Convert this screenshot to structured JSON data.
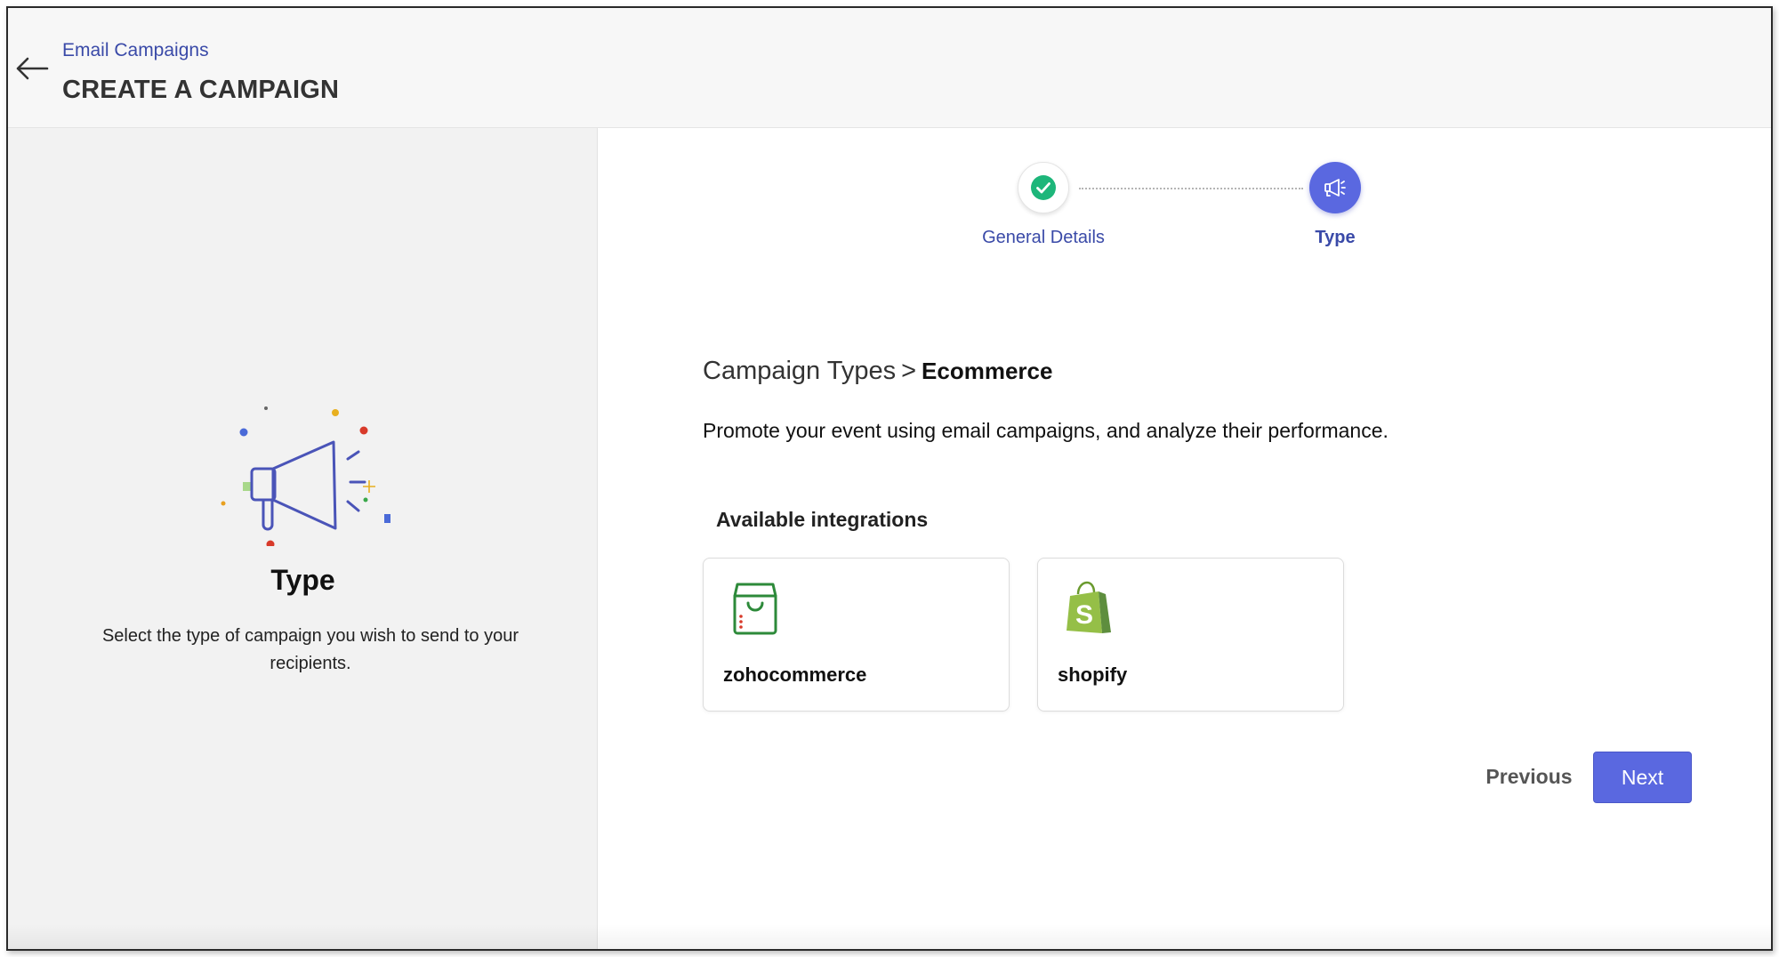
{
  "header": {
    "breadcrumb": "Email Campaigns",
    "title": "CREATE A CAMPAIGN",
    "back_icon": "arrow-left-icon"
  },
  "left_panel": {
    "title": "Type",
    "description": "Select the type of campaign you wish to send to your recipients.",
    "illustration": "megaphone-icon"
  },
  "stepper": {
    "steps": [
      {
        "label": "General Details",
        "status": "completed",
        "icon": "check-icon"
      },
      {
        "label": "Type",
        "status": "active",
        "icon": "megaphone-icon"
      }
    ]
  },
  "content": {
    "crumb_parent": "Campaign Types",
    "crumb_separator": ">",
    "crumb_current": "Ecommerce",
    "description": "Promote your event using email campaigns, and analyze their performance.",
    "integrations_heading": "Available integrations",
    "integrations": [
      {
        "name": "zohocommerce",
        "icon": "shopping-bag-icon"
      },
      {
        "name": "shopify",
        "icon": "shopify-icon"
      }
    ]
  },
  "actions": {
    "previous_label": "Previous",
    "next_label": "Next"
  },
  "colors": {
    "accent": "#5a68e0",
    "link": "#3a4aa8",
    "success": "#1db67a",
    "zoho_green": "#2d8a3a",
    "shopify_green": "#95bf47"
  }
}
